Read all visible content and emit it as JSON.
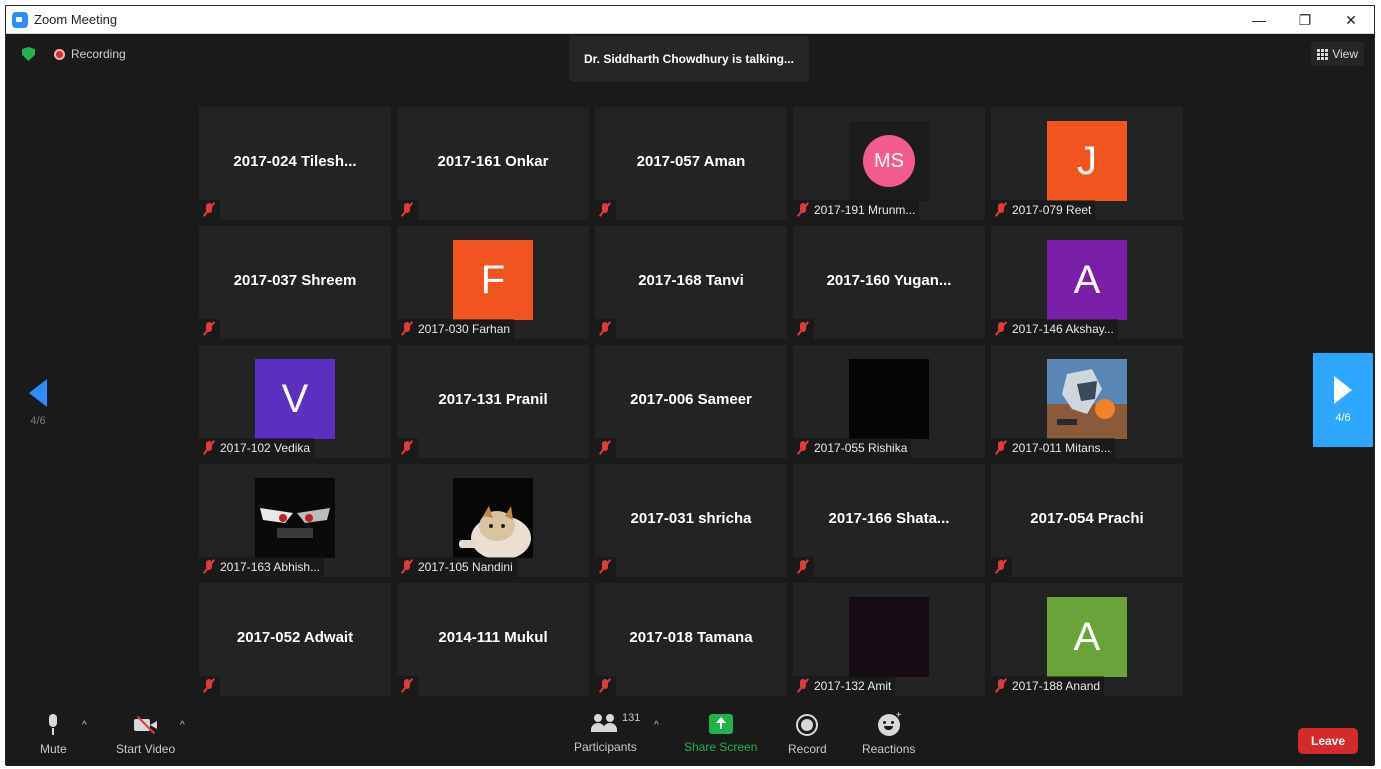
{
  "window": {
    "title": "Zoom Meeting",
    "minimize": "—",
    "restore": "❐",
    "close": "✕"
  },
  "top_bar": {
    "recording_label": "Recording",
    "talking": "Dr. Siddharth Chowdhury is talking...",
    "view_label": "View"
  },
  "pagination": {
    "prev_label": "4/6",
    "next_label": "4/6"
  },
  "tiles": [
    {
      "name": "2017-024 Tilesh...",
      "footer": "",
      "kind": "name"
    },
    {
      "name": "2017-161 Onkar",
      "footer": "",
      "kind": "name"
    },
    {
      "name": "2017-057 Aman",
      "footer": "",
      "kind": "name"
    },
    {
      "name": "",
      "footer": "2017-191 Mrunm...",
      "kind": "circle",
      "initials": "MS",
      "color": "#f25b8b"
    },
    {
      "name": "",
      "footer": "2017-079 Reet",
      "kind": "letter",
      "initials": "J",
      "color": "#f0541f"
    },
    {
      "name": "2017-037 Shreem",
      "footer": "",
      "kind": "name"
    },
    {
      "name": "",
      "footer": "2017-030 Farhan",
      "kind": "letter",
      "initials": "F",
      "color": "#f0541f"
    },
    {
      "name": "2017-168 Tanvi",
      "footer": "",
      "kind": "name"
    },
    {
      "name": "2017-160 Yugan...",
      "footer": "",
      "kind": "name"
    },
    {
      "name": "",
      "footer": "2017-146 Akshay...",
      "kind": "letter",
      "initials": "A",
      "color": "#7a1fa8"
    },
    {
      "name": "",
      "footer": "2017-102 Vedika",
      "kind": "letter",
      "initials": "V",
      "color": "#5b2fc0"
    },
    {
      "name": "2017-131 Pranil",
      "footer": "",
      "kind": "name"
    },
    {
      "name": "2017-006 Sameer",
      "footer": "",
      "kind": "name"
    },
    {
      "name": "",
      "footer": "2017-055 Rishika",
      "kind": "photo-black"
    },
    {
      "name": "",
      "footer": "2017-011 Mitans...",
      "kind": "photo-robot"
    },
    {
      "name": "",
      "footer": "2017-163 Abhish...",
      "kind": "photo-mask"
    },
    {
      "name": "",
      "footer": "2017-105 Nandini",
      "kind": "photo-cat"
    },
    {
      "name": "2017-031 shricha",
      "footer": "",
      "kind": "name"
    },
    {
      "name": "2017-166 Shata...",
      "footer": "",
      "kind": "name"
    },
    {
      "name": "2017-054 Prachi",
      "footer": "",
      "kind": "name"
    },
    {
      "name": "2017-052 Adwait",
      "footer": "",
      "kind": "name"
    },
    {
      "name": "2014-111 Mukul",
      "footer": "",
      "kind": "name"
    },
    {
      "name": "2017-018 Tamana",
      "footer": "",
      "kind": "name"
    },
    {
      "name": "",
      "footer": "2017-132 Amit",
      "kind": "photo-dark"
    },
    {
      "name": "",
      "footer": "2017-188 Anand",
      "kind": "letter",
      "initials": "A",
      "color": "#6aa33a"
    }
  ],
  "toolbar": {
    "mute": "Mute",
    "start_video": "Start Video",
    "participants": "Participants",
    "participants_count": "131",
    "share_screen": "Share Screen",
    "record": "Record",
    "reactions": "Reactions",
    "leave": "Leave"
  },
  "colors": {
    "share_green": "#23b14d",
    "leave_red": "#d32a2a",
    "next_blue": "#2ea8ff"
  }
}
